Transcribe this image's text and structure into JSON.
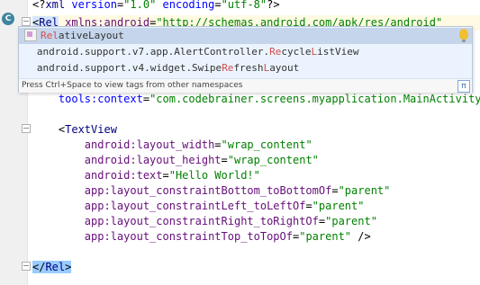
{
  "editor": {
    "gutter_badge": "C",
    "lines": [
      {
        "row": 0,
        "parts": [
          {
            "cls": "pun",
            "t": "<?"
          },
          {
            "cls": "tag",
            "t": "xml "
          },
          {
            "cls": "attr",
            "t": "version"
          },
          {
            "cls": "pun",
            "t": "="
          },
          {
            "cls": "val",
            "t": "\"1.0\""
          },
          {
            "cls": "attr",
            "t": " encoding"
          },
          {
            "cls": "pun",
            "t": "="
          },
          {
            "cls": "val",
            "t": "\"utf-8\""
          },
          {
            "cls": "pun",
            "t": "?>"
          }
        ]
      },
      {
        "row": 1,
        "parts": [
          {
            "cls": "pun caret-tag",
            "t": "<"
          },
          {
            "cls": "tag caret-tag",
            "t": "Rel"
          },
          {
            "cls": "ns",
            "t": " xmlns:android"
          },
          {
            "cls": "pun",
            "t": "="
          },
          {
            "cls": "val",
            "t": "\"http://schemas.android.com/apk/res/android\""
          }
        ]
      },
      {
        "row": 6,
        "parts": [
          {
            "cls": "attr",
            "t": "    tools:context"
          },
          {
            "cls": "pun",
            "t": "="
          },
          {
            "cls": "val",
            "t": "\"com.codebrainer.screens.myapplication.MainActivity\""
          },
          {
            "cls": "pun",
            "t": ">"
          }
        ]
      },
      {
        "row": 8,
        "parts": [
          {
            "cls": "pun",
            "t": "    <"
          },
          {
            "cls": "tag",
            "t": "TextView"
          }
        ]
      },
      {
        "row": 9,
        "parts": [
          {
            "cls": "ns",
            "t": "        android:layout_width"
          },
          {
            "cls": "pun",
            "t": "="
          },
          {
            "cls": "val",
            "t": "\"wrap_content\""
          }
        ]
      },
      {
        "row": 10,
        "parts": [
          {
            "cls": "ns",
            "t": "        android:layout_height"
          },
          {
            "cls": "pun",
            "t": "="
          },
          {
            "cls": "val",
            "t": "\"wrap_content\""
          }
        ]
      },
      {
        "row": 11,
        "parts": [
          {
            "cls": "ns",
            "t": "        android:text"
          },
          {
            "cls": "pun",
            "t": "="
          },
          {
            "cls": "val",
            "t": "\"Hello World!\""
          }
        ]
      },
      {
        "row": 12,
        "parts": [
          {
            "cls": "ns",
            "t": "        app:layout_constraintBottom_toBottomOf"
          },
          {
            "cls": "pun",
            "t": "="
          },
          {
            "cls": "val",
            "t": "\"parent\""
          }
        ]
      },
      {
        "row": 13,
        "parts": [
          {
            "cls": "ns",
            "t": "        app:layout_constraintLeft_toLeftOf"
          },
          {
            "cls": "pun",
            "t": "="
          },
          {
            "cls": "val",
            "t": "\"parent\""
          }
        ]
      },
      {
        "row": 14,
        "parts": [
          {
            "cls": "ns",
            "t": "        app:layout_constraintRight_toRightOf"
          },
          {
            "cls": "pun",
            "t": "="
          },
          {
            "cls": "val",
            "t": "\"parent\""
          }
        ]
      },
      {
        "row": 15,
        "parts": [
          {
            "cls": "ns",
            "t": "        app:layout_constraintTop_toTopOf"
          },
          {
            "cls": "pun",
            "t": "="
          },
          {
            "cls": "val",
            "t": "\"parent\""
          },
          {
            "cls": "pun",
            "t": " />"
          }
        ]
      },
      {
        "row": 17,
        "parts": [
          {
            "cls": "pun end-tag-box",
            "t": "</"
          },
          {
            "cls": "tag end-tag-box",
            "t": "Rel"
          },
          {
            "cls": "pun end-tag-box",
            "t": ">"
          }
        ]
      }
    ]
  },
  "completion": {
    "items": [
      {
        "prefix": "",
        "before": "",
        "match1": "Rel",
        "mid": "ativeLayout",
        "match2": "",
        "after": "",
        "selected": true
      },
      {
        "prefix": "android.support.v7.app.AlertController.",
        "before": "",
        "match1": "Re",
        "mid": "cycle",
        "match2": "L",
        "after": "istView",
        "selected": false
      },
      {
        "prefix": "android.support.v4.widget.Swipe",
        "before": "",
        "match1": "Re",
        "mid": "fresh",
        "match2": "L",
        "after": "ayout",
        "selected": false
      }
    ],
    "footer_text": "Press Ctrl+Space to view tags from other namespaces",
    "footer_icon": "π"
  }
}
